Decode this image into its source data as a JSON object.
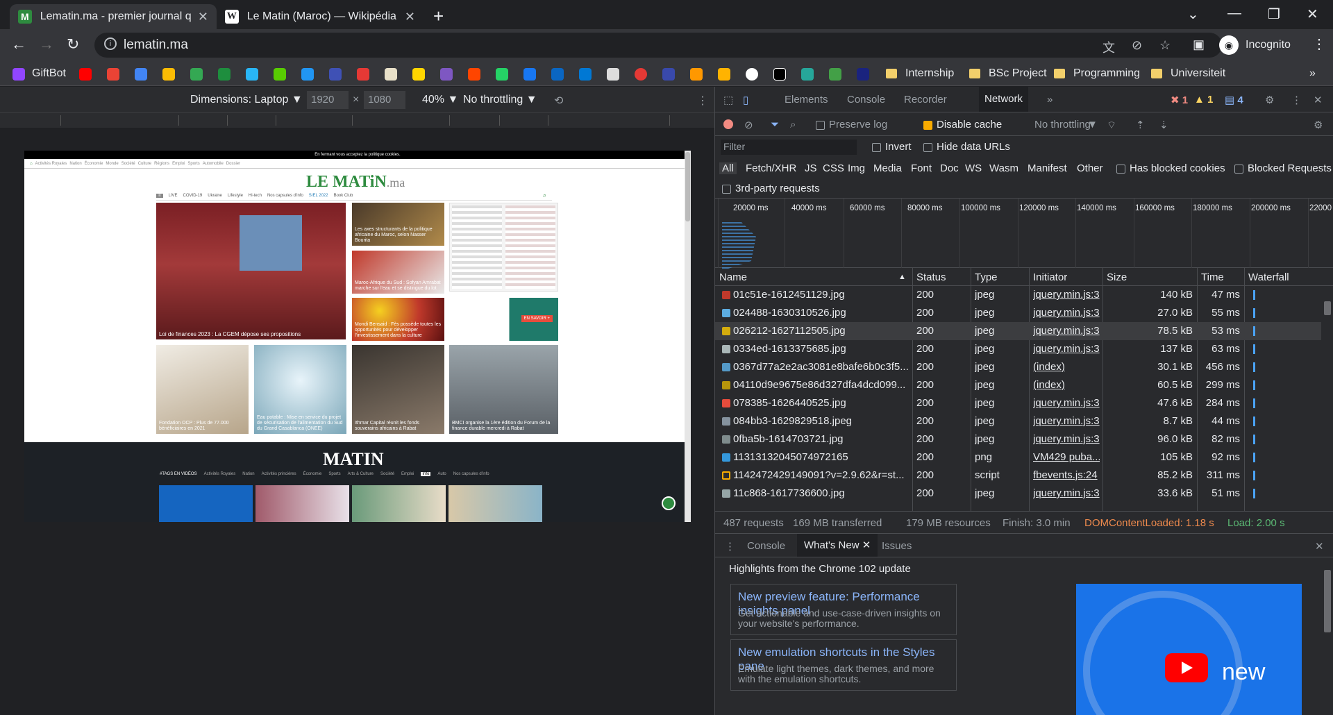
{
  "browser": {
    "tabs": [
      {
        "title": "Lematin.ma - premier journal quotidien",
        "favicon": "M"
      },
      {
        "title": "Le Matin (Maroc) — Wikipédia",
        "favicon": "W"
      }
    ],
    "url": "lematin.ma",
    "profile_label": "Incognito"
  },
  "bookmarks": {
    "first": "GiftBot",
    "folders": [
      "Internship",
      "BSc Project",
      "Programming",
      "Universiteit"
    ],
    "more": "»"
  },
  "device_toolbar": {
    "dimensions": "Dimensions: Laptop ▼",
    "width": "1920",
    "times": "×",
    "height": "1080",
    "zoom": "40% ▼",
    "throttling": "No throttling ▼"
  },
  "page": {
    "cookie_bar": "En fermant vous acceptez la politique cookies.",
    "top_nav": [
      "Activités Royales",
      "Nation",
      "Économie",
      "Monde",
      "Société",
      "Culture",
      "Régions",
      "Emploi",
      "Sports",
      "Automobile",
      "Dossier"
    ],
    "logo_main": "LE MATiN",
    "logo_suffix": ".ma",
    "nav": [
      "LIVE",
      "COVID-19",
      "Ukraine",
      "Lifestyle",
      "Hi-tech",
      "Nos capsules d'info",
      "SIEL 2022",
      "Book Club"
    ],
    "articles": [
      "Loi de finances 2023 : La CGEM dépose ses propositions",
      "Les axes structurants de la politique africaine du Maroc, selon Nasser Bourita",
      "Maroc-Afrique du Sud : Sofyan Amrabat marche sur l'eau et se distingue du lot",
      "Mondi Bensaid : Fès possède toutes les opportunités pour développer l'investissement dans la culture",
      "Fondation OCP : Plus de 77.000 bénéficiaires en 2021",
      "Eau potable : Mise en service du projet de sécurisation de l'alimentation du Sud du Grand Casablanca (ONEE)",
      "Ithmar Capital réunit les fonds souverains africains à Rabat",
      "BMCI organise la 1ère édition du Forum de la finance durable mercredi à Rabat"
    ],
    "tv_title": "MATIN",
    "tv_cats": [
      "#TAGS EN VIDÉOS",
      "Activités Royales",
      "Nation",
      "Activités princières",
      "Économie",
      "Sports",
      "Arts & Culture",
      "Société",
      "Emploi",
      "Info",
      "Auto",
      "Nos capsules d'info"
    ],
    "promo": "EN SAVOIR +"
  },
  "devtools": {
    "tabs": [
      "Elements",
      "Console",
      "Recorder",
      "Network"
    ],
    "errors": "1",
    "warnings": "1",
    "messages": "4",
    "toolbar": {
      "preserve_log": "Preserve log",
      "disable_cache": "Disable cache",
      "throttling": "No throttling"
    },
    "filter_placeholder": "Filter",
    "invert": "Invert",
    "hide_data_urls": "Hide data URLs",
    "types": [
      "All",
      "Fetch/XHR",
      "JS",
      "CSS",
      "Img",
      "Media",
      "Font",
      "Doc",
      "WS",
      "Wasm",
      "Manifest",
      "Other"
    ],
    "has_blocked_cookies": "Has blocked cookies",
    "blocked_requests": "Blocked Requests",
    "third_party": "3rd-party requests",
    "timeline_ticks": [
      "20000 ms",
      "40000 ms",
      "60000 ms",
      "80000 ms",
      "100000 ms",
      "120000 ms",
      "140000 ms",
      "160000 ms",
      "180000 ms",
      "200000 ms",
      "22000"
    ],
    "columns": [
      "Name",
      "Status",
      "Type",
      "Initiator",
      "Size",
      "Time",
      "Waterfall"
    ],
    "rows": [
      {
        "name": "01c51e-1612451129.jpg",
        "status": "200",
        "type": "jpeg",
        "initiator": "jquery.min.js:3",
        "size": "140 kB",
        "time": "47 ms"
      },
      {
        "name": "024488-1630310526.jpg",
        "status": "200",
        "type": "jpeg",
        "initiator": "jquery.min.js:3",
        "size": "27.0 kB",
        "time": "55 ms"
      },
      {
        "name": "026212-1627112505.jpg",
        "status": "200",
        "type": "jpeg",
        "initiator": "jquery.min.js:3",
        "size": "78.5 kB",
        "time": "53 ms"
      },
      {
        "name": "0334ed-1613375685.jpg",
        "status": "200",
        "type": "jpeg",
        "initiator": "jquery.min.js:3",
        "size": "137 kB",
        "time": "63 ms"
      },
      {
        "name": "0367d77a2e2ac3081e8bafe6b0c3f5...",
        "status": "200",
        "type": "jpeg",
        "initiator": "(index)",
        "size": "30.1 kB",
        "time": "456 ms"
      },
      {
        "name": "04110d9e9675e86d327dfa4dcd099...",
        "status": "200",
        "type": "jpeg",
        "initiator": "(index)",
        "size": "60.5 kB",
        "time": "299 ms"
      },
      {
        "name": "078385-1626440525.jpg",
        "status": "200",
        "type": "jpeg",
        "initiator": "jquery.min.js:3",
        "size": "47.6 kB",
        "time": "284 ms"
      },
      {
        "name": "084bb3-1629829518.jpeg",
        "status": "200",
        "type": "jpeg",
        "initiator": "jquery.min.js:3",
        "size": "8.7 kB",
        "time": "44 ms"
      },
      {
        "name": "0fba5b-1614703721.jpg",
        "status": "200",
        "type": "jpeg",
        "initiator": "jquery.min.js:3",
        "size": "96.0 kB",
        "time": "82 ms"
      },
      {
        "name": "1131313204507497216​5",
        "status": "200",
        "type": "png",
        "initiator": "VM429 puba...",
        "size": "105 kB",
        "time": "92 ms"
      },
      {
        "name": "1142472429149091?v=2.9.62&r=st...",
        "status": "200",
        "type": "script",
        "initiator": "fbevents.js:24",
        "size": "85.2 kB",
        "time": "311 ms"
      },
      {
        "name": "11c868-1617736600.jpg",
        "status": "200",
        "type": "jpeg",
        "initiator": "jquery.min.js:3",
        "size": "33.6 kB",
        "time": "51 ms"
      }
    ],
    "summary": {
      "requests": "487 requests",
      "transferred": "169 MB transferred",
      "resources": "179 MB resources",
      "finish": "Finish: 3.0 min",
      "dcl": "DOMContentLoaded: 1.18 s",
      "load": "Load: 2.00 s"
    },
    "drawer_tabs": [
      "Console",
      "What's New",
      "Issues"
    ],
    "whats_new_title": "Highlights from the Chrome 102 update",
    "cards": [
      {
        "title": "New preview feature: Performance insights panel",
        "desc": "Get actionable and use-case-driven insights on your website's performance."
      },
      {
        "title": "New emulation shortcuts in the Styles pane",
        "desc": "Emulate light themes, dark themes, and more with the emulation shortcuts."
      }
    ],
    "promo_text": "new"
  }
}
